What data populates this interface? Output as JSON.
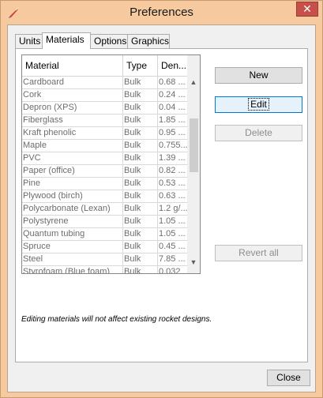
{
  "window": {
    "title": "Preferences",
    "close_glyph": "✕",
    "app_icon": "rocket-icon"
  },
  "tabs": [
    "Units",
    "Materials",
    "Options",
    "Graphics"
  ],
  "active_tab": "Materials",
  "table": {
    "columns": [
      "Material",
      "Type",
      "Den..."
    ],
    "rows": [
      [
        "Cardboard",
        "Bulk",
        "0.68 ..."
      ],
      [
        "Cork",
        "Bulk",
        "0.24 ..."
      ],
      [
        "Depron (XPS)",
        "Bulk",
        "0.04 ..."
      ],
      [
        "Fiberglass",
        "Bulk",
        "1.85 ..."
      ],
      [
        "Kraft phenolic",
        "Bulk",
        "0.95 ..."
      ],
      [
        "Maple",
        "Bulk",
        "0.755..."
      ],
      [
        "PVC",
        "Bulk",
        "1.39 ..."
      ],
      [
        "Paper (office)",
        "Bulk",
        "0.82 ..."
      ],
      [
        "Pine",
        "Bulk",
        "0.53 ..."
      ],
      [
        "Plywood (birch)",
        "Bulk",
        "0.63 ..."
      ],
      [
        "Polycarbonate (Lexan)",
        "Bulk",
        "1.2 g/..."
      ],
      [
        "Polystyrene",
        "Bulk",
        "1.05 ..."
      ],
      [
        "Quantum tubing",
        "Bulk",
        "1.05 ..."
      ],
      [
        "Spruce",
        "Bulk",
        "0.45 ..."
      ],
      [
        "Steel",
        "Bulk",
        "7.85 ..."
      ],
      [
        "Styrofoam (Blue foam)",
        "Bulk",
        "0.032..."
      ]
    ]
  },
  "buttons": {
    "new": "New",
    "edit": "Edit",
    "delete": "Delete",
    "revert_all": "Revert all",
    "close": "Close"
  },
  "note": "Editing materials will not affect existing rocket designs."
}
